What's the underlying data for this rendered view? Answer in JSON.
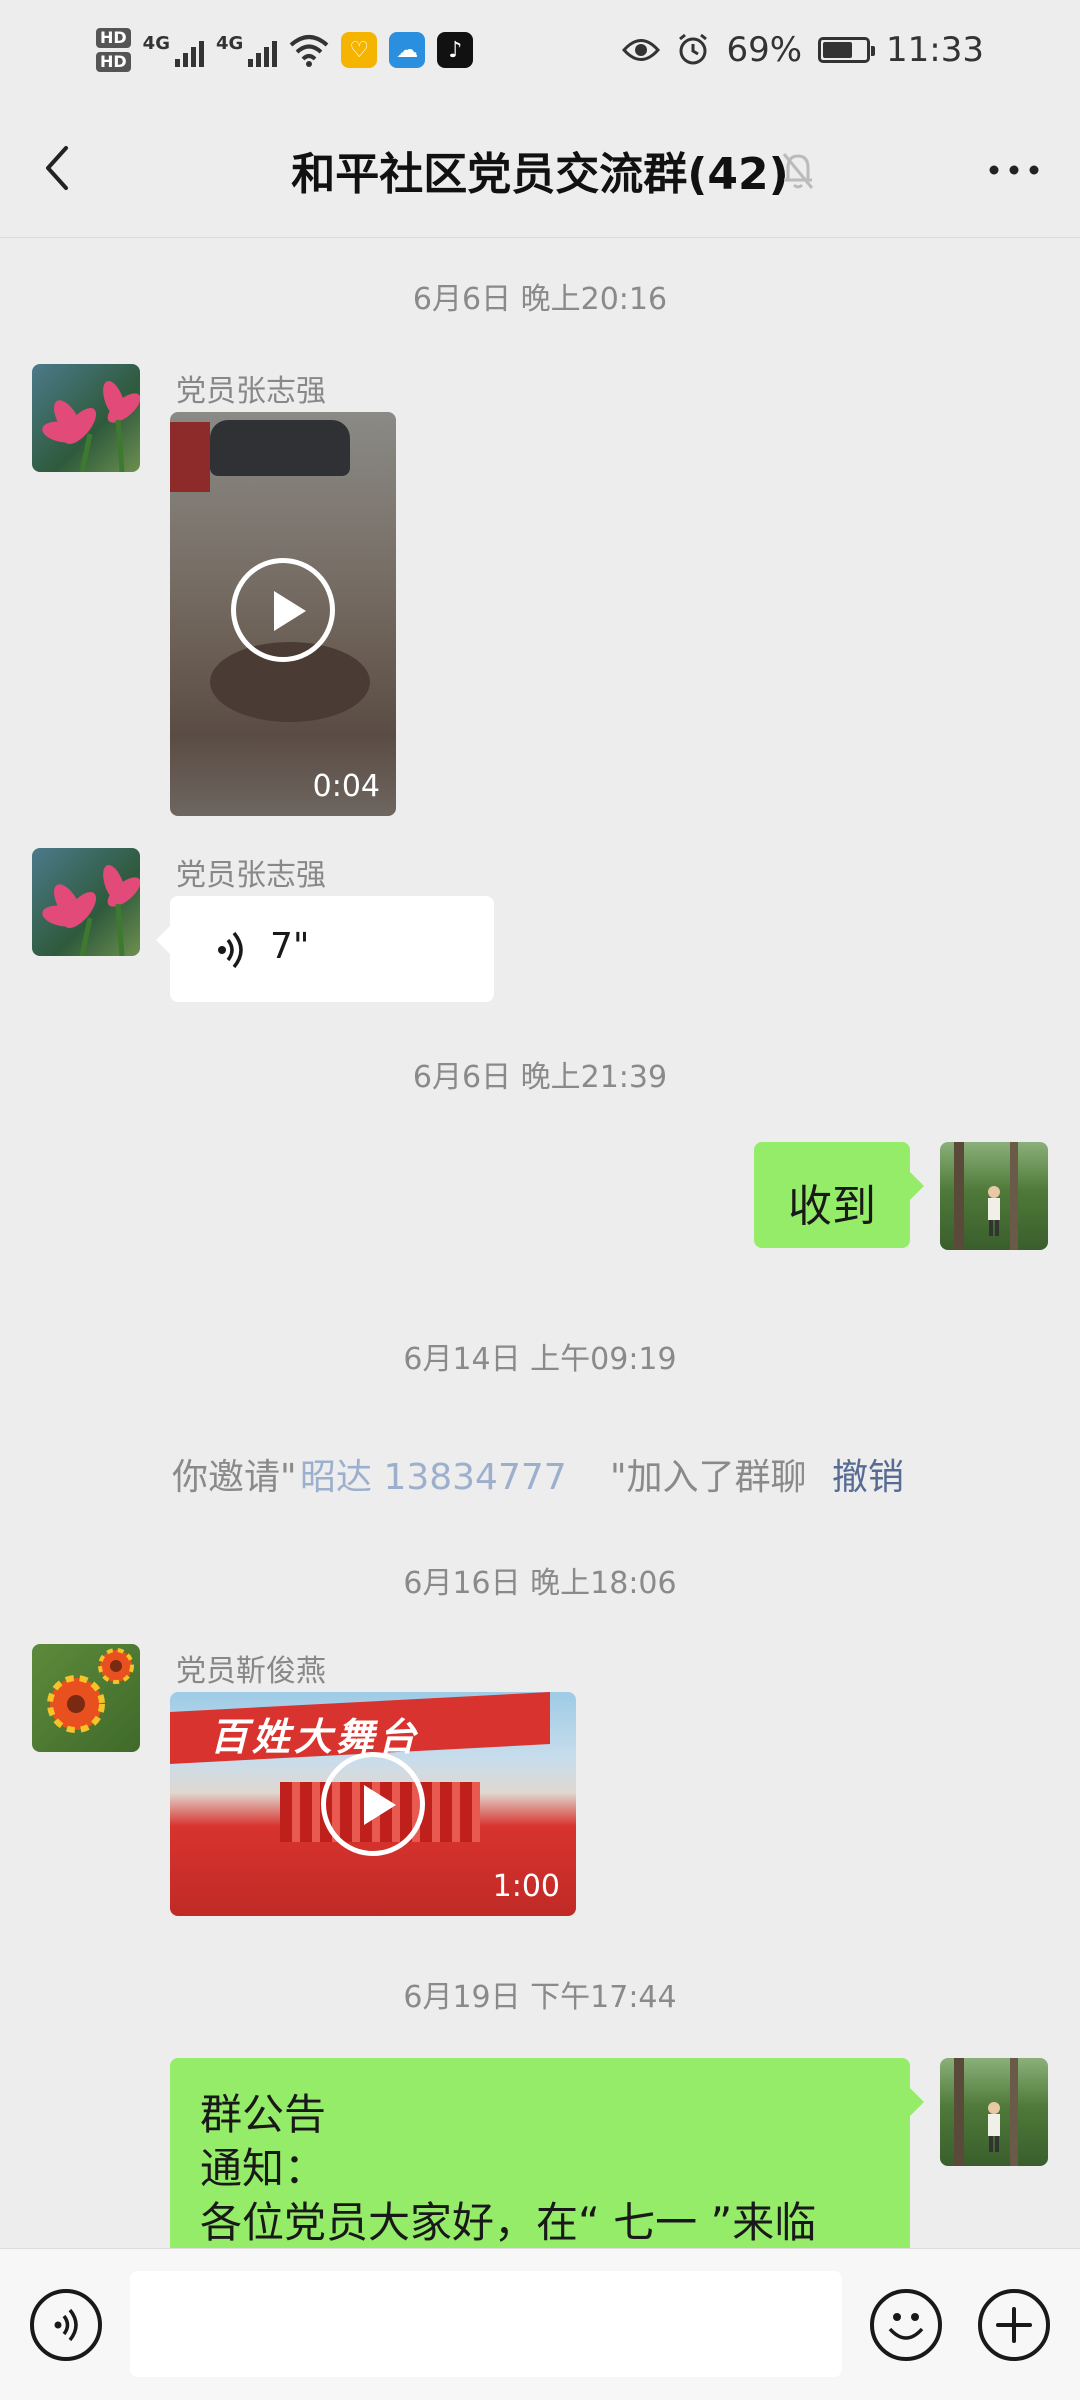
{
  "status_bar": {
    "hd1": "HD",
    "hd2": "HD",
    "net1": "4G",
    "net2": "4G",
    "battery_percent": "69%",
    "battery_level": 0.69,
    "time": "11:33"
  },
  "nav": {
    "title": "和平社区党员交流群(42)"
  },
  "messages": {
    "ts1": "6月6日 晚上20:16",
    "sender1": "党员张志强",
    "video1_duration": "0:04",
    "sender2": "党员张志强",
    "voice_duration": "7\"",
    "ts2": "6月6日 晚上21:39",
    "out1": "收到",
    "ts3": "6月14日 上午09:19",
    "system_prefix": "你邀请\"",
    "system_name": "昭达 13834777",
    "system_suffix": "\"加入了群聊",
    "system_revoke": "撤销",
    "ts4": "6月16日 晚上18:06",
    "sender3": "党员靳俊燕",
    "video2_banner": "百姓大舞台",
    "video2_duration": "1:00",
    "ts5": "6月19日 下午17:44",
    "notice_title": "群公告",
    "notice_line2": "通知：",
    "notice_line3": "各位党员大家好，在“ 七一 ”来临"
  },
  "input": {
    "placeholder": ""
  },
  "colors": {
    "bubble_out": "#95ec69",
    "background": "#ededed",
    "link": "#576b95"
  },
  "icons": {
    "back": "chevron-left-icon",
    "mute": "bell-off-icon",
    "more": "more-dots-icon",
    "voice": "voice-icon",
    "emoji": "emoji-icon",
    "plus": "plus-icon"
  }
}
